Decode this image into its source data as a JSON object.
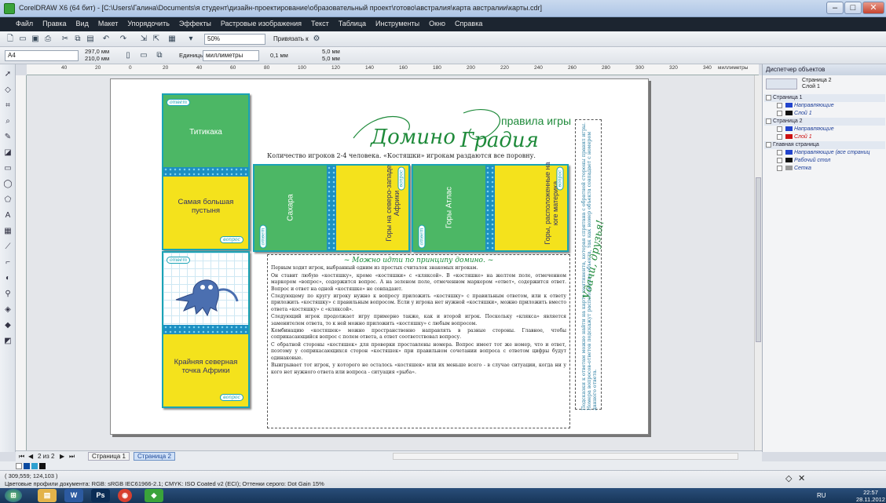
{
  "window": {
    "title": "CorelDRAW X6 (64 бит) - [C:\\Users\\Галина\\Documents\\я студент\\дизайн-проектирование\\образовательный проект\\готово\\австралия\\карта австралии\\карты.cdr]",
    "min": "–",
    "max": "□",
    "close": "✕"
  },
  "menu": [
    "Файл",
    "Правка",
    "Вид",
    "Макет",
    "Упорядочить",
    "Эффекты",
    "Растровые изображения",
    "Текст",
    "Таблица",
    "Инструменты",
    "Окно",
    "Справка"
  ],
  "toolbar1": {
    "zoom": "50%",
    "snap": "Привязать к"
  },
  "toolbar2": {
    "page_size": "A4",
    "width": "297,0 мм",
    "height": "210,0 мм",
    "units_label": "Единицы:",
    "units": "миллиметры",
    "nudge": "0,1 мм",
    "dup_x": "5,0 мм",
    "dup_y": "5,0 мм"
  },
  "ruler": {
    "ticks": [
      "40",
      "20",
      "0",
      "20",
      "40",
      "60",
      "80",
      "100",
      "120",
      "140",
      "160",
      "180",
      "200",
      "220",
      "240",
      "260",
      "280",
      "300",
      "320",
      "340"
    ],
    "unit": "миллиметры"
  },
  "document": {
    "logo_left": "Домино",
    "logo_right": "Градия",
    "rules_title": "правила игры",
    "intro": "Количество игроков 2-4 человека. «Костяшки» игрокам раздаются все поровну.",
    "badge_question": "вопрос",
    "badge_answer": "ответ",
    "card1_top": "Титикака",
    "card1_bottom": "Самая большая пустыня",
    "card2_top": "",
    "card2_bottom": "Крайняя северная точка Африки",
    "card3_left": "Сахара",
    "card3_right": "Горы на северо-западе Африки",
    "card4_left": "Горы Атлас",
    "card4_right": "Горы, расположенные на юге материка",
    "rules_heading": "~ Можно идти по принципу домино. ~",
    "rules": [
      "Первым ходит игрок, выбранный одним из простых считалок знакомых игрокам.",
      "Он ставит любую «костяшку», кроме «костяшки» с «кляксой». В «костяшке» на желтом поле, отмеченном маркером «вопрос», содержится вопрос. А на зеленом поле, отмеченном маркером «ответ», содержится ответ. Вопрос и ответ на одной «костяшке» не совпадают.",
      "Следующему по кругу игроку нужно к вопросу приложить «костяшку» с правильным ответом, или к ответу приложить «костяшку» с правильным вопросом. Если у игрока нет нужной «костяшки», можно приложить вместо ответа «костяшку» с «кляксой».",
      "Следующий игрок продолжает игру примерно также, как и второй игрок. Поскольку «клякса» является заменителем ответа, то к ней можно приложить «костяшку» с любым вопросом.",
      "Комбинацию «костяшек» можно пространственно направлять в разные стороны. Главное, чтобы соприкасающийся вопрос с полем ответа, а ответ соответствовал вопросу.",
      "С обратной стороны «костяшек» для проверки проставлены номера. Вопрос имеет тот же номер, что и ответ, поэтому у соприкасающихся сторон «костяшек» при правильном сочетании вопроса с ответом цифры будут одинаковые.",
      "Выигрывает тот игрок, у которого не осталось «костяшек» или их меньше всего - в случае ситуации, когда ни у кого нет нужного ответа или вопроса - ситуация «рыба»."
    ],
    "side_note": "Подсказки к ответам можно найти на карте континента, которая спрятана с обратной стороны правил игры. Номера вопросов-ответов подскажут расположение объекта, так как номер объекта совпадает с номером данного ответа.",
    "side_sign": "Удачи, друзья!"
  },
  "object_manager": {
    "title": "Диспетчер объектов",
    "current_page": "Страница 2",
    "current_layer": "Слой 1",
    "rows": [
      {
        "label": "Страница 1",
        "level": 0,
        "color": ""
      },
      {
        "label": "Направляющие",
        "level": 1,
        "color": "#2244cc"
      },
      {
        "label": "Слой 1",
        "level": 1,
        "color": "#111111"
      },
      {
        "label": "Страница 2",
        "level": 0,
        "color": ""
      },
      {
        "label": "Направляющие",
        "level": 1,
        "color": "#2244cc"
      },
      {
        "label": "Слой 1",
        "level": 1,
        "color": "#cc1111"
      },
      {
        "label": "Главная страница",
        "level": 0,
        "color": ""
      },
      {
        "label": "Направляющие (все страниц",
        "level": 1,
        "color": "#2244cc"
      },
      {
        "label": "Рабочий стол",
        "level": 1,
        "color": "#111111"
      },
      {
        "label": "Сетка",
        "level": 1,
        "color": "#999999"
      }
    ]
  },
  "page_tabs": {
    "counter": "2 из 2",
    "tab1": "Страница 1",
    "tab2": "Страница 2"
  },
  "status": {
    "coords": "( 309,559; 124,103 )",
    "profiles": "Цветовые профили документа: RGB: sRGB IEC61966-2.1; CMYK: ISO Coated v2 (ECI); Оттенки серого: Dot Gain 15%"
  },
  "taskbar": {
    "lang": "RU",
    "time": "22:57",
    "date": "28.11.2012"
  }
}
